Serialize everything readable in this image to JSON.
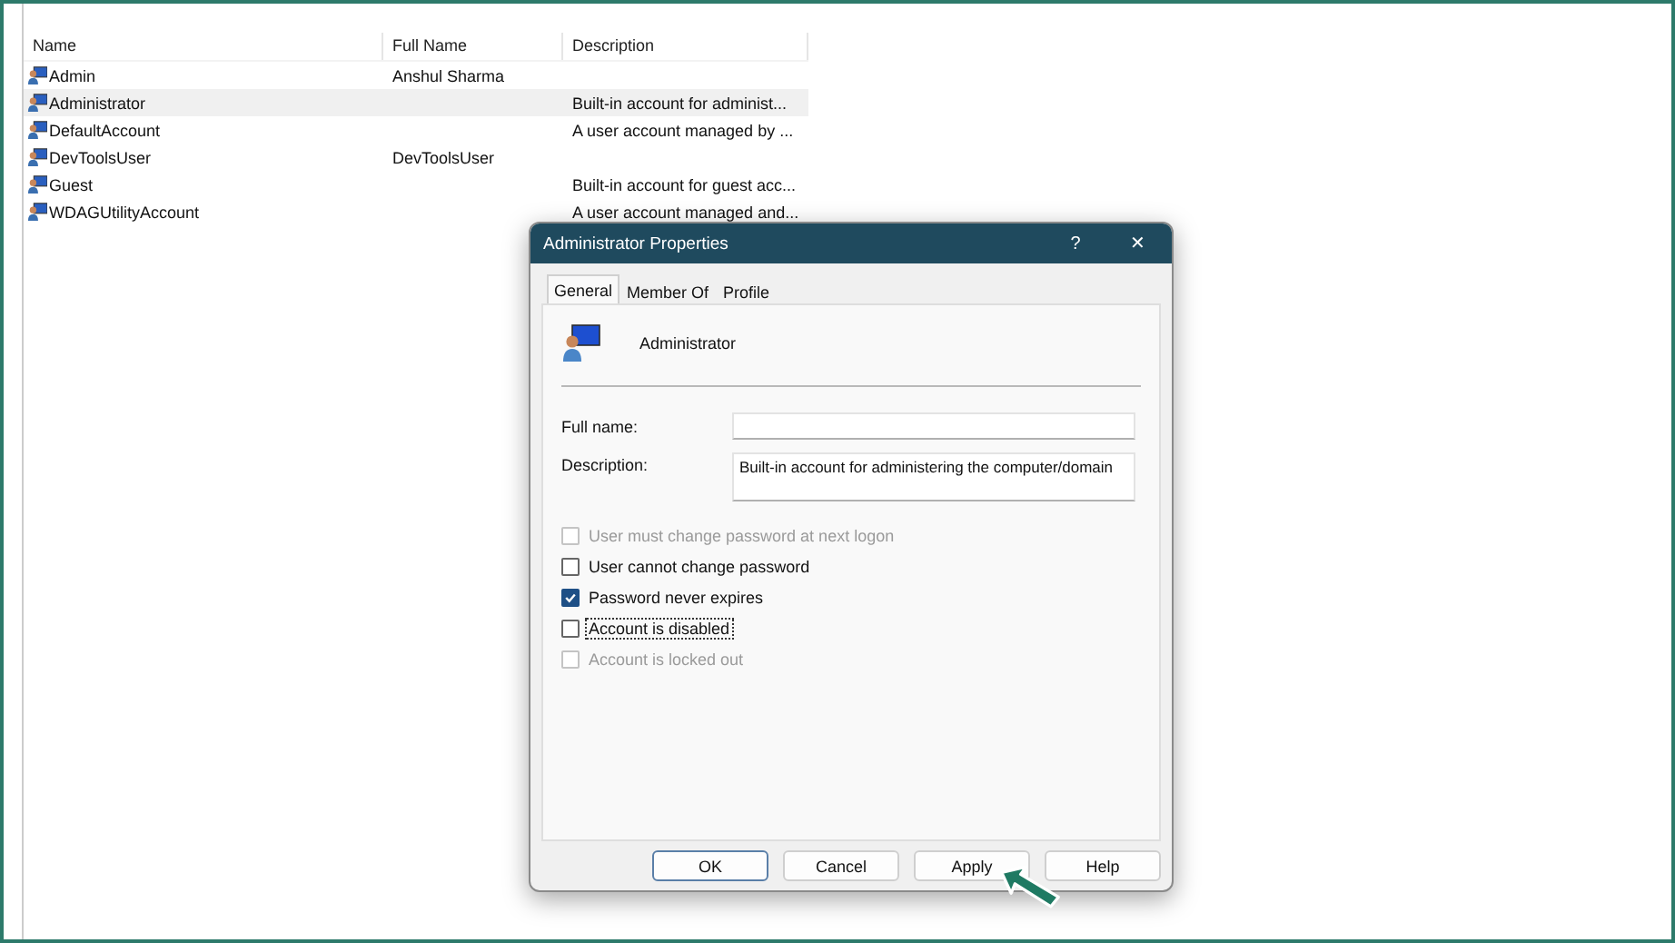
{
  "list": {
    "columns": [
      "Name",
      "Full Name",
      "Description"
    ],
    "rows": [
      {
        "name": "Admin",
        "full_name": "Anshul Sharma",
        "selected": false
      },
      {
        "name": "Administrator",
        "description": "Built-in account for administ...",
        "selected": true
      },
      {
        "name": "DefaultAccount",
        "description": "A user account managed by ...",
        "selected": false
      },
      {
        "name": "DevToolsUser",
        "full_name": "DevToolsUser",
        "selected": false
      },
      {
        "name": "Guest",
        "description": "Built-in account for guest acc...",
        "selected": false
      },
      {
        "name": "WDAGUtilityAccount",
        "description": "A user account managed and...",
        "selected": false
      }
    ]
  },
  "dialog": {
    "title": "Administrator Properties",
    "help": "?",
    "close": "✕",
    "tabs": [
      {
        "label": "General",
        "selected": true
      },
      {
        "label": "Member Of",
        "selected": false
      },
      {
        "label": "Profile",
        "selected": false
      }
    ],
    "user_name": "Administrator",
    "fields": [
      {
        "label": "Full name:"
      },
      {
        "label": "Description:",
        "value": "Built-in account for administering the computer/domain"
      }
    ],
    "options": [
      {
        "label": "User must change password at next logon",
        "checked": false,
        "disabled": true,
        "focused": false
      },
      {
        "label": "User cannot change password",
        "checked": false,
        "disabled": false,
        "focused": false
      },
      {
        "label": "Password never expires",
        "checked": true,
        "disabled": false,
        "focused": false
      },
      {
        "label": "Account is disabled",
        "checked": false,
        "disabled": false,
        "focused": true
      },
      {
        "label": "Account is locked out",
        "checked": false,
        "disabled": true,
        "focused": false
      }
    ],
    "buttons": [
      {
        "label": "OK",
        "default": true
      },
      {
        "label": "Cancel",
        "default": false
      },
      {
        "label": "Apply",
        "default": false
      },
      {
        "label": "Help",
        "default": false
      }
    ]
  }
}
